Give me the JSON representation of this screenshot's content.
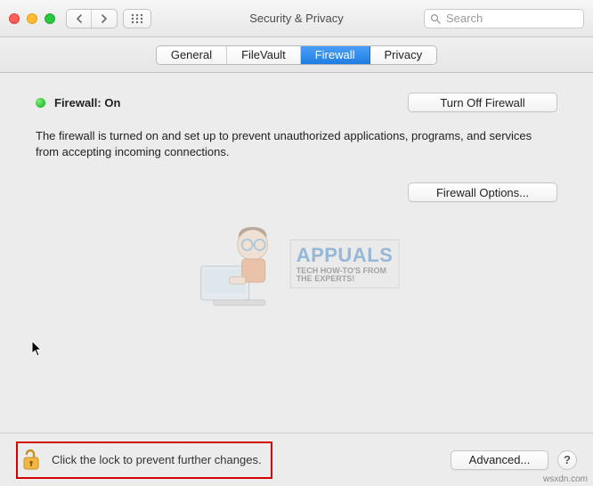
{
  "titlebar": {
    "title": "Security & Privacy",
    "search_placeholder": "Search"
  },
  "tabs": {
    "items": [
      "General",
      "FileVault",
      "Firewall",
      "Privacy"
    ],
    "active_index": 2
  },
  "firewall": {
    "status_label": "Firewall: On",
    "turn_off_label": "Turn Off Firewall",
    "description": "The firewall is turned on and set up to prevent unauthorized applications, programs, and services from accepting incoming connections.",
    "options_label": "Firewall Options..."
  },
  "footer": {
    "lock_text": "Click the lock to prevent further changes.",
    "advanced_label": "Advanced...",
    "help_label": "?"
  },
  "watermark": {
    "title": "APPUALS",
    "sub1": "TECH HOW-TO'S FROM",
    "sub2": "THE EXPERTS!"
  },
  "credit": "wsxdn.com"
}
